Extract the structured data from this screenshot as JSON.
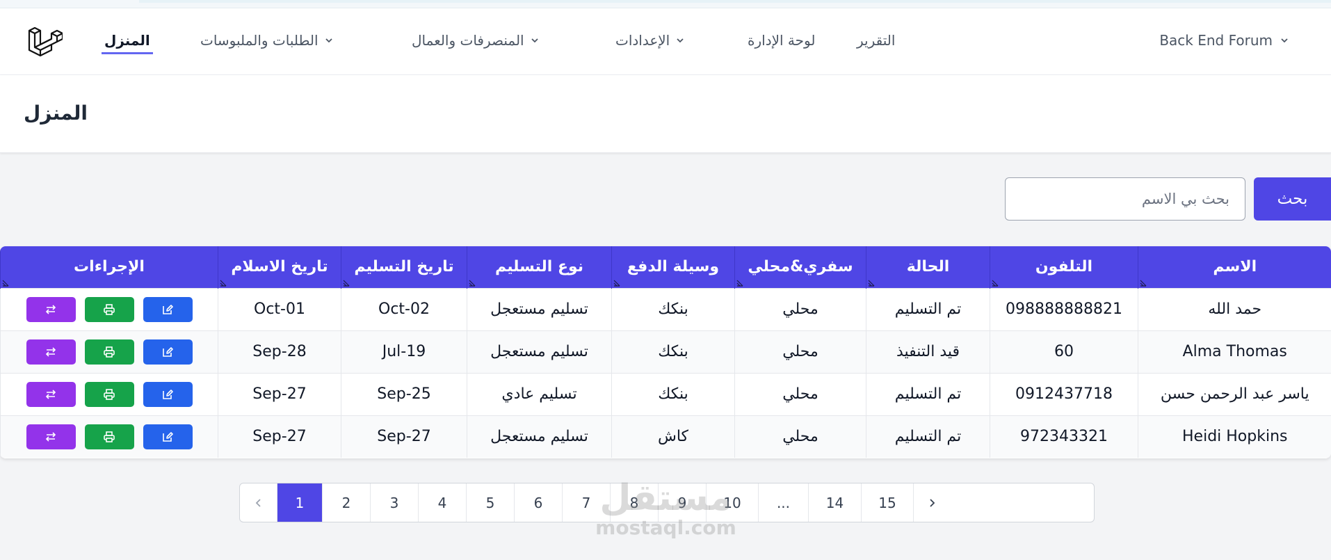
{
  "nav": {
    "home": "المنزل",
    "orders": "الطلبات والملبوسات",
    "expenses": "المنصرفات والعمال",
    "settings": "الإعدادات",
    "dashboard": "لوحة الإدارة",
    "report": "التقرير",
    "user": "Back End Forum"
  },
  "header": {
    "title": "المنزل"
  },
  "search": {
    "button_label": "بحث",
    "placeholder": "بحث بي الاسم"
  },
  "table": {
    "columns": [
      "الاسم",
      "التلفون",
      "الحالة",
      "سفري&محلي",
      "وسيلة الدفع",
      "نوع التسليم",
      "تاريخ التسليم",
      "تاريخ الاسلام",
      "الإجراءات"
    ],
    "rows": [
      [
        "حمد الله",
        "098888888821",
        "تم التسليم",
        "محلي",
        "بنكك",
        "تسليم مستعجل",
        "Oct-02",
        "Oct-01"
      ],
      [
        "Alma Thomas",
        "60",
        "قيد التنفيذ",
        "محلي",
        "بنكك",
        "تسليم مستعجل",
        "Jul-19",
        "Sep-28"
      ],
      [
        "ياسر عبد الرحمن حسن",
        "0912437718",
        "تم التسليم",
        "محلي",
        "بنكك",
        "تسليم عادي",
        "Sep-25",
        "Sep-27"
      ],
      [
        "Heidi Hopkins",
        "972343321",
        "تم التسليم",
        "محلي",
        "كاش",
        "تسليم مستعجل",
        "Sep-27",
        "Sep-27"
      ]
    ]
  },
  "pagination": {
    "pages": [
      "1",
      "2",
      "3",
      "4",
      "5",
      "6",
      "7",
      "8",
      "9",
      "10",
      "...",
      "14",
      "15"
    ],
    "current": "1"
  },
  "watermark": {
    "arabic": "مستقل",
    "latin": "mostaql.com"
  },
  "colors": {
    "primary": "#4f46e5",
    "edit": "#2563eb",
    "print": "#16a34a",
    "transfer": "#9333ea"
  }
}
